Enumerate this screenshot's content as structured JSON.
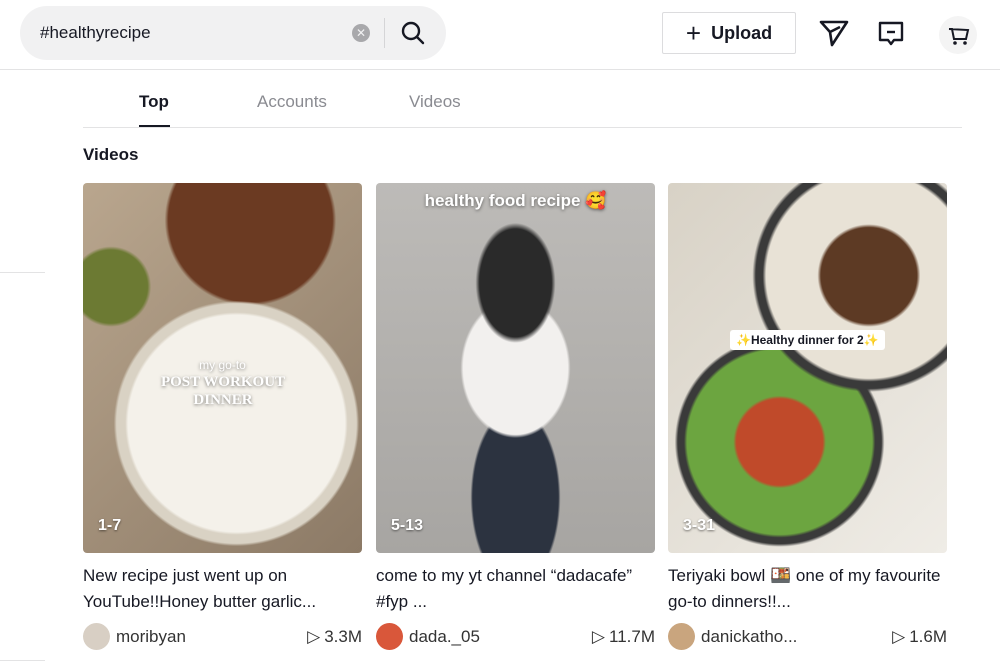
{
  "search": {
    "value": "#healthyrecipe"
  },
  "header": {
    "upload_label": "Upload"
  },
  "tabs": [
    {
      "label": "Top"
    },
    {
      "label": "Accounts"
    },
    {
      "label": "Videos"
    }
  ],
  "section_title": "Videos",
  "videos": [
    {
      "caption": "New recipe just went up on YouTube!!Honey butter garlic...",
      "author": "moribyan",
      "views": "3.3M",
      "date": "1-7",
      "overlay_small": "my go-to",
      "overlay_big": "POST WORKOUT DINNER"
    },
    {
      "caption": "come to my yt channel “dadacafe” #fyp ...",
      "author": "dada._05",
      "views": "11.7M",
      "date": "5-13",
      "overlay_big": "healthy food recipe 🥰"
    },
    {
      "caption": "Teriyaki bowl 🍱 one of my favourite go-to dinners!!...",
      "author": "danickatho...",
      "views": "1.6M",
      "date": "3-31",
      "overlay_big": "✨Healthy dinner for 2✨"
    }
  ]
}
